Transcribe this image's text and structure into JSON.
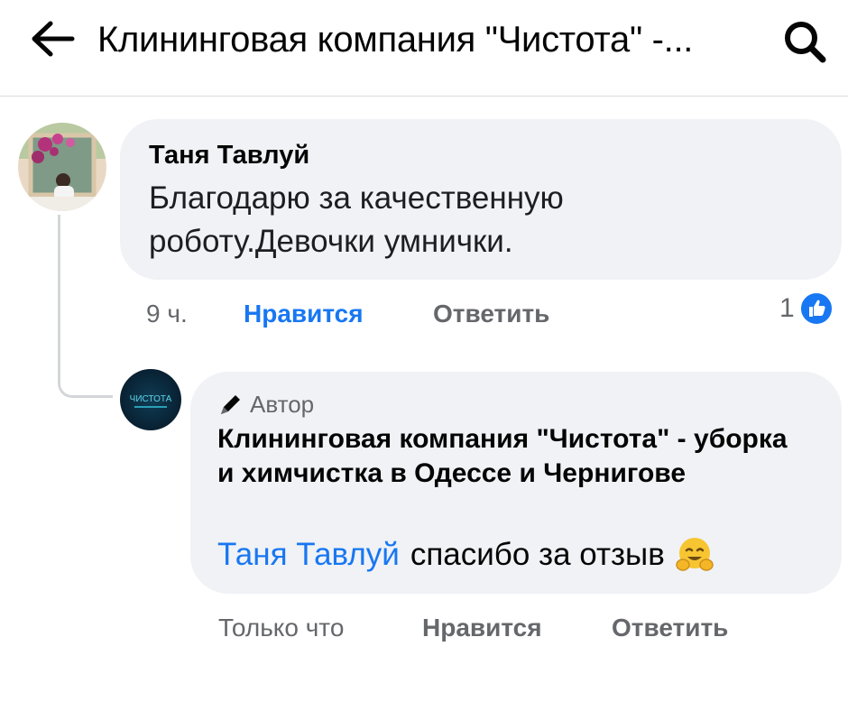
{
  "header": {
    "title": "Клининговая компания \"Чистота\" -..."
  },
  "comment": {
    "author": "Таня Тавлуй",
    "text": "Благодарю за качественную роботу.Девочки умнички.",
    "time": "9 ч.",
    "like_label": "Нравится",
    "reply_label": "Ответить",
    "reactions_count": "1"
  },
  "reply": {
    "badge_label": "Автор",
    "author": "Клининговая компания \"Чистота\" - уборка и химчистка в Одессе и Чернигове",
    "mention": "Таня Тавлуй",
    "text": "спасибо за отзыв",
    "time": "Только что",
    "like_label": "Нравится",
    "reply_label": "Ответить",
    "avatar_logo_text": "ЧИСТОТА"
  },
  "icons": {
    "back": "arrow-left-icon",
    "search": "search-icon",
    "author_badge": "pencil-icon",
    "reaction": "thumbs-up-icon",
    "emoji": "hugging-face-emoji"
  },
  "colors": {
    "accent": "#1877f2",
    "bubble": "#f0f2f5",
    "muted": "#65676b"
  }
}
